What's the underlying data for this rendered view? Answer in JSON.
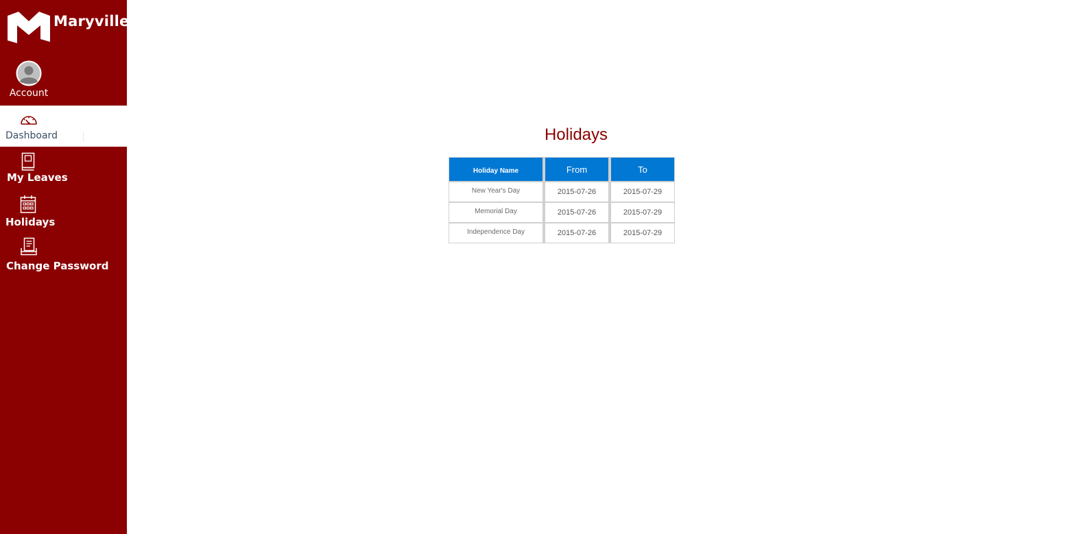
{
  "app": {
    "brand_name": "Maryville",
    "brand_color": "#8b0000",
    "accent_color": "#0078d4"
  },
  "sidebar": {
    "account_label": "Account",
    "items": [
      {
        "label": "Dashboard",
        "icon": "speedometer-icon",
        "active": true
      },
      {
        "label": "My Leaves",
        "icon": "book-icon",
        "active": false
      },
      {
        "label": "Holidays",
        "icon": "calendar-icon",
        "active": false
      },
      {
        "label": "Change Password",
        "icon": "document-stack-icon",
        "active": false
      }
    ]
  },
  "main": {
    "title": "Holidays",
    "table": {
      "headers": [
        "Holiday Name",
        "From",
        "To"
      ],
      "rows": [
        [
          "New Year's Day",
          "2015-07-26",
          "2015-07-29"
        ],
        [
          "Memorial Day",
          "2015-07-26",
          "2015-07-29"
        ],
        [
          "Independence Day",
          "2015-07-26",
          "2015-07-29"
        ]
      ]
    }
  }
}
